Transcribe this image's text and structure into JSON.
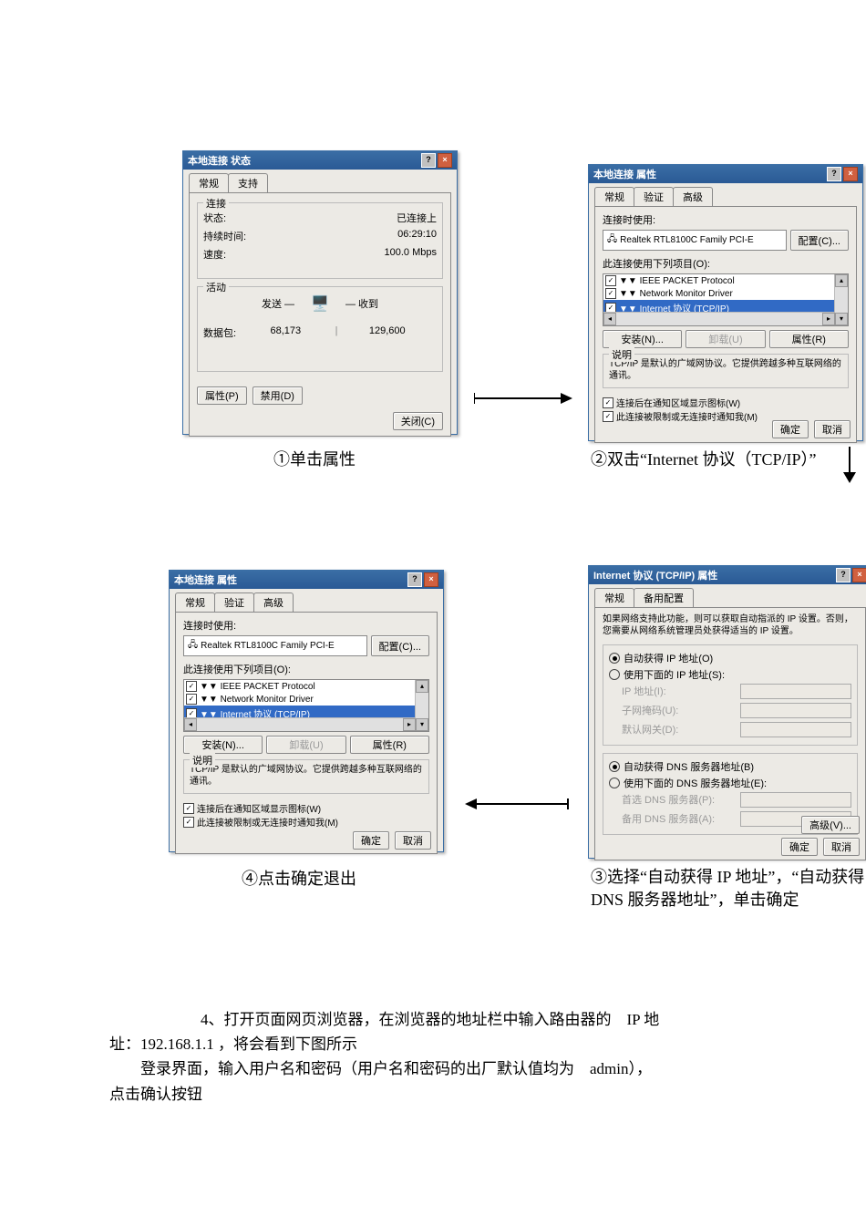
{
  "dialogs": {
    "status": {
      "title": "本地连接 状态",
      "tabs": [
        "常规",
        "支持"
      ],
      "group_conn": "连接",
      "rows": {
        "state_l": "状态:",
        "state_v": "已连接上",
        "time_l": "持续时间:",
        "time_v": "06:29:10",
        "speed_l": "速度:",
        "speed_v": "100.0 Mbps"
      },
      "group_act": "活动",
      "act_sent": "发送 —",
      "act_recv": "— 收到",
      "pkt_l": "数据包:",
      "pkt_sent": "68,173",
      "pkt_recv": "129,600",
      "btn_prop": "属性(P)",
      "btn_disable": "禁用(D)",
      "btn_close": "关闭(C)"
    },
    "prop": {
      "title": "本地连接 属性",
      "tabs": [
        "常规",
        "验证",
        "高级"
      ],
      "use_l": "连接时使用:",
      "adapter": "Realtek RTL8100C Family PCI-E",
      "btn_cfg": "配置(C)...",
      "items_l": "此连接使用下列项目(O):",
      "items": [
        "▼▼ IEEE PACKET Protocol",
        "▼▼ Network Monitor Driver",
        "▼▼ Internet 协议 (TCP/IP)"
      ],
      "btn_install": "安装(N)...",
      "btn_uninstall": "卸载(U)",
      "btn_props": "属性(R)",
      "desc_l": "说明",
      "desc": "TCP/IP 是默认的广域网协议。它提供跨越多种互联网络的通讯。",
      "chk1": "连接后在通知区域显示图标(W)",
      "chk2": "此连接被限制或无连接时通知我(M)",
      "btn_ok": "确定",
      "btn_cancel": "取消"
    },
    "tcpip": {
      "title": "Internet 协议 (TCP/IP) 属性",
      "tabs": [
        "常规",
        "备用配置"
      ],
      "intro": "如果网络支持此功能，则可以获取自动指派的 IP 设置。否则，您需要从网络系统管理员处获得适当的 IP 设置。",
      "r_auto_ip": "自动获得 IP 地址(O)",
      "r_manual_ip": "使用下面的 IP 地址(S):",
      "ip_l": "IP 地址(I):",
      "mask_l": "子网掩码(U):",
      "gw_l": "默认网关(D):",
      "r_auto_dns": "自动获得 DNS 服务器地址(B)",
      "r_manual_dns": "使用下面的 DNS 服务器地址(E):",
      "dns1_l": "首选 DNS 服务器(P):",
      "dns2_l": "备用 DNS 服务器(A):",
      "btn_adv": "高级(V)...",
      "btn_ok": "确定",
      "btn_cancel": "取消"
    }
  },
  "captions": {
    "c1": "①单击属性",
    "c2": "②双击“Internet 协议（TCP/IP）”",
    "c3": "③选择“自动获得 IP 地址”，“自动获得 DNS 服务器地址”，单击确定",
    "c4": "④点击确定退出"
  },
  "body": {
    "p1a": "4、打开页面网页浏览器，在浏览器的地址栏中输入路由器的",
    "p1b": "IP 地",
    "p1c": "址：192.168.1.1 ，将会看到下图所示",
    "p2a": "登录界面，输入用户名和密码（用户名和密码的出厂默认值均为",
    "p2b": "admin），",
    "p2c": "点击确认按钮"
  }
}
